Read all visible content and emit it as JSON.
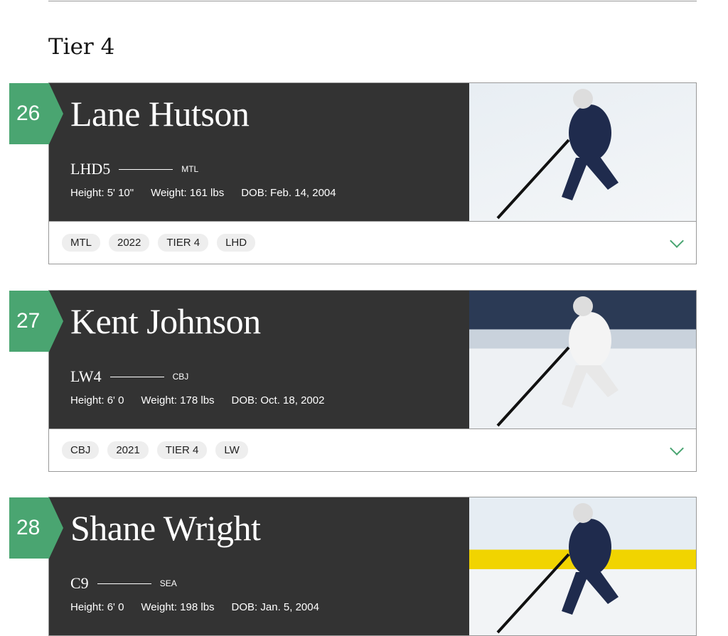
{
  "section_title": "Tier 4",
  "colors": {
    "accent": "#4aa571",
    "card_bg": "#333333"
  },
  "players": [
    {
      "rank": "26",
      "name": "Lane Hutson",
      "position": "LHD5",
      "team": "MTL",
      "height": "Height: 5' 10\"",
      "weight": "Weight: 161 lbs",
      "dob": "DOB: Feb. 14, 2004",
      "tags": [
        "MTL",
        "2022",
        "TIER 4",
        "LHD"
      ],
      "photo_colors": [
        "#e8eef3",
        "#f4f6f8"
      ]
    },
    {
      "rank": "27",
      "name": "Kent Johnson",
      "position": "LW4",
      "team": "CBJ",
      "height": "Height: 6' 0",
      "weight": "Weight: 178 lbs",
      "dob": "DOB: Oct. 18, 2002",
      "tags": [
        "CBJ",
        "2021",
        "TIER 4",
        "LW"
      ],
      "photo_colors": [
        "#2b3a55",
        "#eef1f4"
      ]
    },
    {
      "rank": "28",
      "name": "Shane Wright",
      "position": "C9",
      "team": "SEA",
      "height": "Height: 6' 0",
      "weight": "Weight: 198 lbs",
      "dob": "DOB: Jan. 5, 2004",
      "tags": [],
      "photo_colors": [
        "#e6edf3",
        "#f1d400"
      ]
    }
  ]
}
